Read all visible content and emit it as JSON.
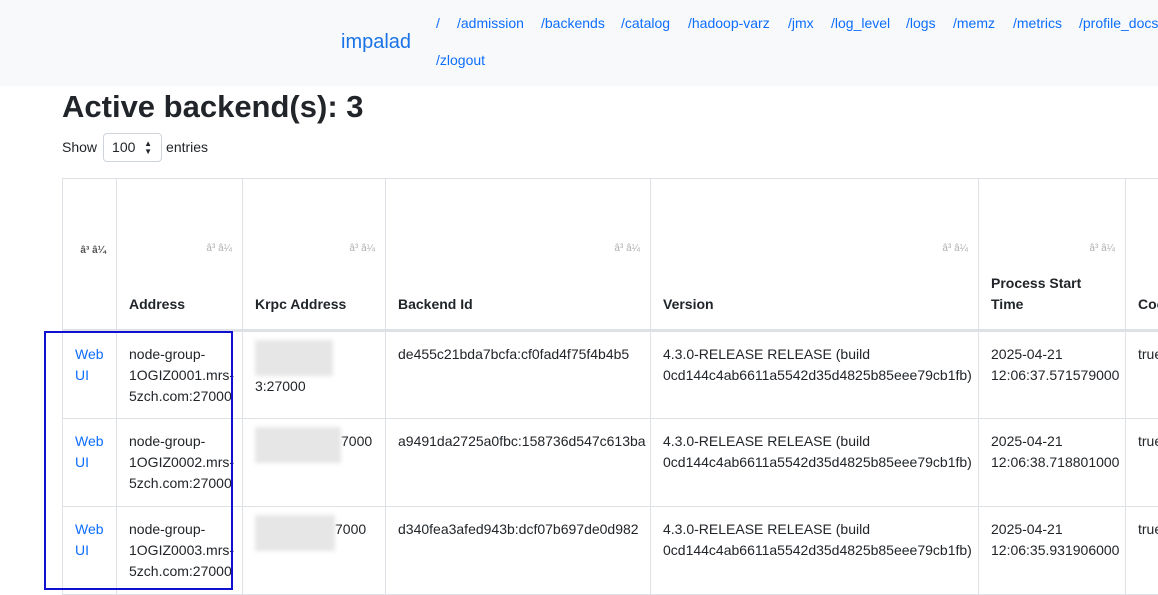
{
  "navbar": {
    "brand": "impalad",
    "links": [
      "/",
      "/admission",
      "/backends",
      "/catalog",
      "/hadoop-varz",
      "/jmx",
      "/log_level",
      "/logs",
      "/memz",
      "/metrics",
      "/profile_docs",
      "/zlogout"
    ]
  },
  "page": {
    "title": "Active backend(s): 3"
  },
  "length_control": {
    "show_label": "Show",
    "selected": "100",
    "entries_label": "entries"
  },
  "table": {
    "sort_glyph": "â³ â¼",
    "sort_glyph_first": "â³ â¼",
    "headers": [
      "",
      "Address",
      "Krpc Address",
      "Backend Id",
      "Version",
      "Process Start Time",
      "Coo"
    ],
    "rows": [
      {
        "link": "Web UI",
        "address": "node-group-1OGIZ0001.mrs-5zch.com:27000",
        "krpc_suffix": "3:27000",
        "backend_id": "de455c21bda7bcfa:cf0fad4f75f4b4b5",
        "version": "4.3.0-RELEASE RELEASE (build 0cd144c4ab6611a5542d35d4825b85eee79cb1fb)",
        "start_time": "2025-04-21 12:06:37.571579000",
        "coord": "true"
      },
      {
        "link": "Web UI",
        "address": "node-group-1OGIZ0002.mrs-5zch.com:27000",
        "krpc_suffix": "7000",
        "backend_id": "a9491da2725a0fbc:158736d547c613ba",
        "version": "4.3.0-RELEASE RELEASE (build 0cd144c4ab6611a5542d35d4825b85eee79cb1fb)",
        "start_time": "2025-04-21 12:06:38.718801000",
        "coord": "true"
      },
      {
        "link": "Web UI",
        "address": "node-group-1OGIZ0003.mrs-5zch.com:27000",
        "krpc_suffix": "7000",
        "backend_id": "d340fea3afed943b:dcf07b697de0d982",
        "version": "4.3.0-RELEASE RELEASE (build 0cd144c4ab6611a5542d35d4825b85eee79cb1fb)",
        "start_time": "2025-04-21 12:06:35.931906000",
        "coord": "true"
      }
    ]
  },
  "colors": {
    "link": "#0d6efd",
    "navbar_bg": "#f8f9fa",
    "highlight": "#1010d0"
  }
}
